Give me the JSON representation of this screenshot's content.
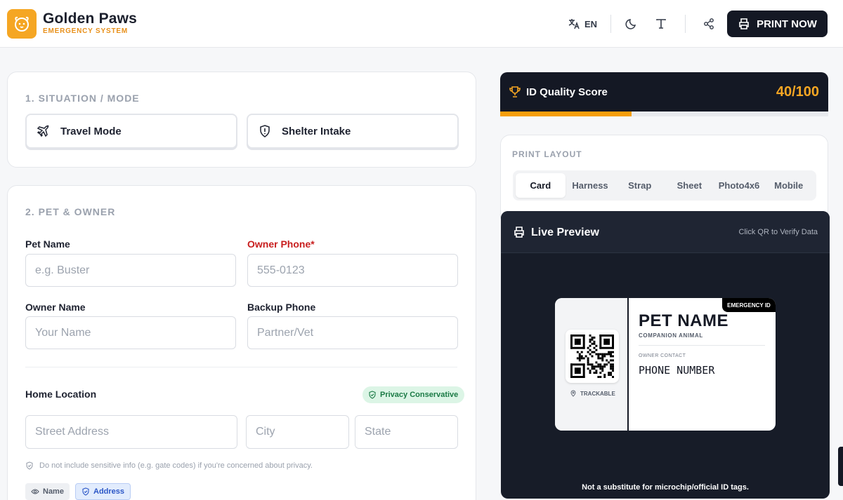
{
  "header": {
    "brand_title": "Golden Paws",
    "brand_subtitle": "EMERGENCY SYSTEM",
    "language_label": "EN",
    "print_label": "PRINT NOW"
  },
  "situation": {
    "title": "1. SITUATION / MODE",
    "modes": [
      {
        "label": "Travel Mode",
        "icon": "plane-icon"
      },
      {
        "label": "Shelter Intake",
        "icon": "shield-alert-icon"
      }
    ]
  },
  "pet_owner": {
    "title": "2. PET & OWNER",
    "pet_name": {
      "label": "Pet Name",
      "placeholder": "e.g. Buster",
      "value": ""
    },
    "owner_phone": {
      "label": "Owner Phone*",
      "placeholder": "555-0123",
      "value": ""
    },
    "owner_name": {
      "label": "Owner Name",
      "placeholder": "Your Name",
      "value": ""
    },
    "backup_phone": {
      "label": "Backup Phone",
      "placeholder": "Partner/Vet",
      "value": ""
    },
    "home_location": {
      "label": "Home Location",
      "badge": "Privacy Conservative",
      "street_placeholder": "Street Address",
      "city_placeholder": "City",
      "state_placeholder": "State",
      "hint": "Do not include sensitive info (e.g. gate codes) if you're concerned about privacy."
    },
    "chips": [
      {
        "label": "Name",
        "icon": "eye-icon"
      },
      {
        "label": "Address",
        "icon": "shield-check-icon"
      }
    ]
  },
  "quality": {
    "label": "ID Quality Score",
    "score_text": "40/100",
    "score_fraction": 0.4
  },
  "print_layout": {
    "title": "PRINT LAYOUT",
    "tabs": [
      "Card",
      "Harness",
      "Strap",
      "Sheet",
      "Photo4x6",
      "Mobile"
    ],
    "active": "Card"
  },
  "preview": {
    "title": "Live Preview",
    "hint": "Click QR to Verify Data",
    "footer": "Not a substitute for microchip/official ID tags.",
    "card": {
      "tag": "EMERGENCY ID",
      "pet_name": "PET NAME",
      "subtitle": "COMPANION ANIMAL",
      "owner_contact_label": "OWNER CONTACT",
      "phone": "PHONE NUMBER",
      "trackable": "TRACKABLE"
    }
  },
  "colors": {
    "brand": "#f5a623",
    "dark": "#141824",
    "required": "#c81e1e",
    "privacy": "#1a7a45"
  }
}
